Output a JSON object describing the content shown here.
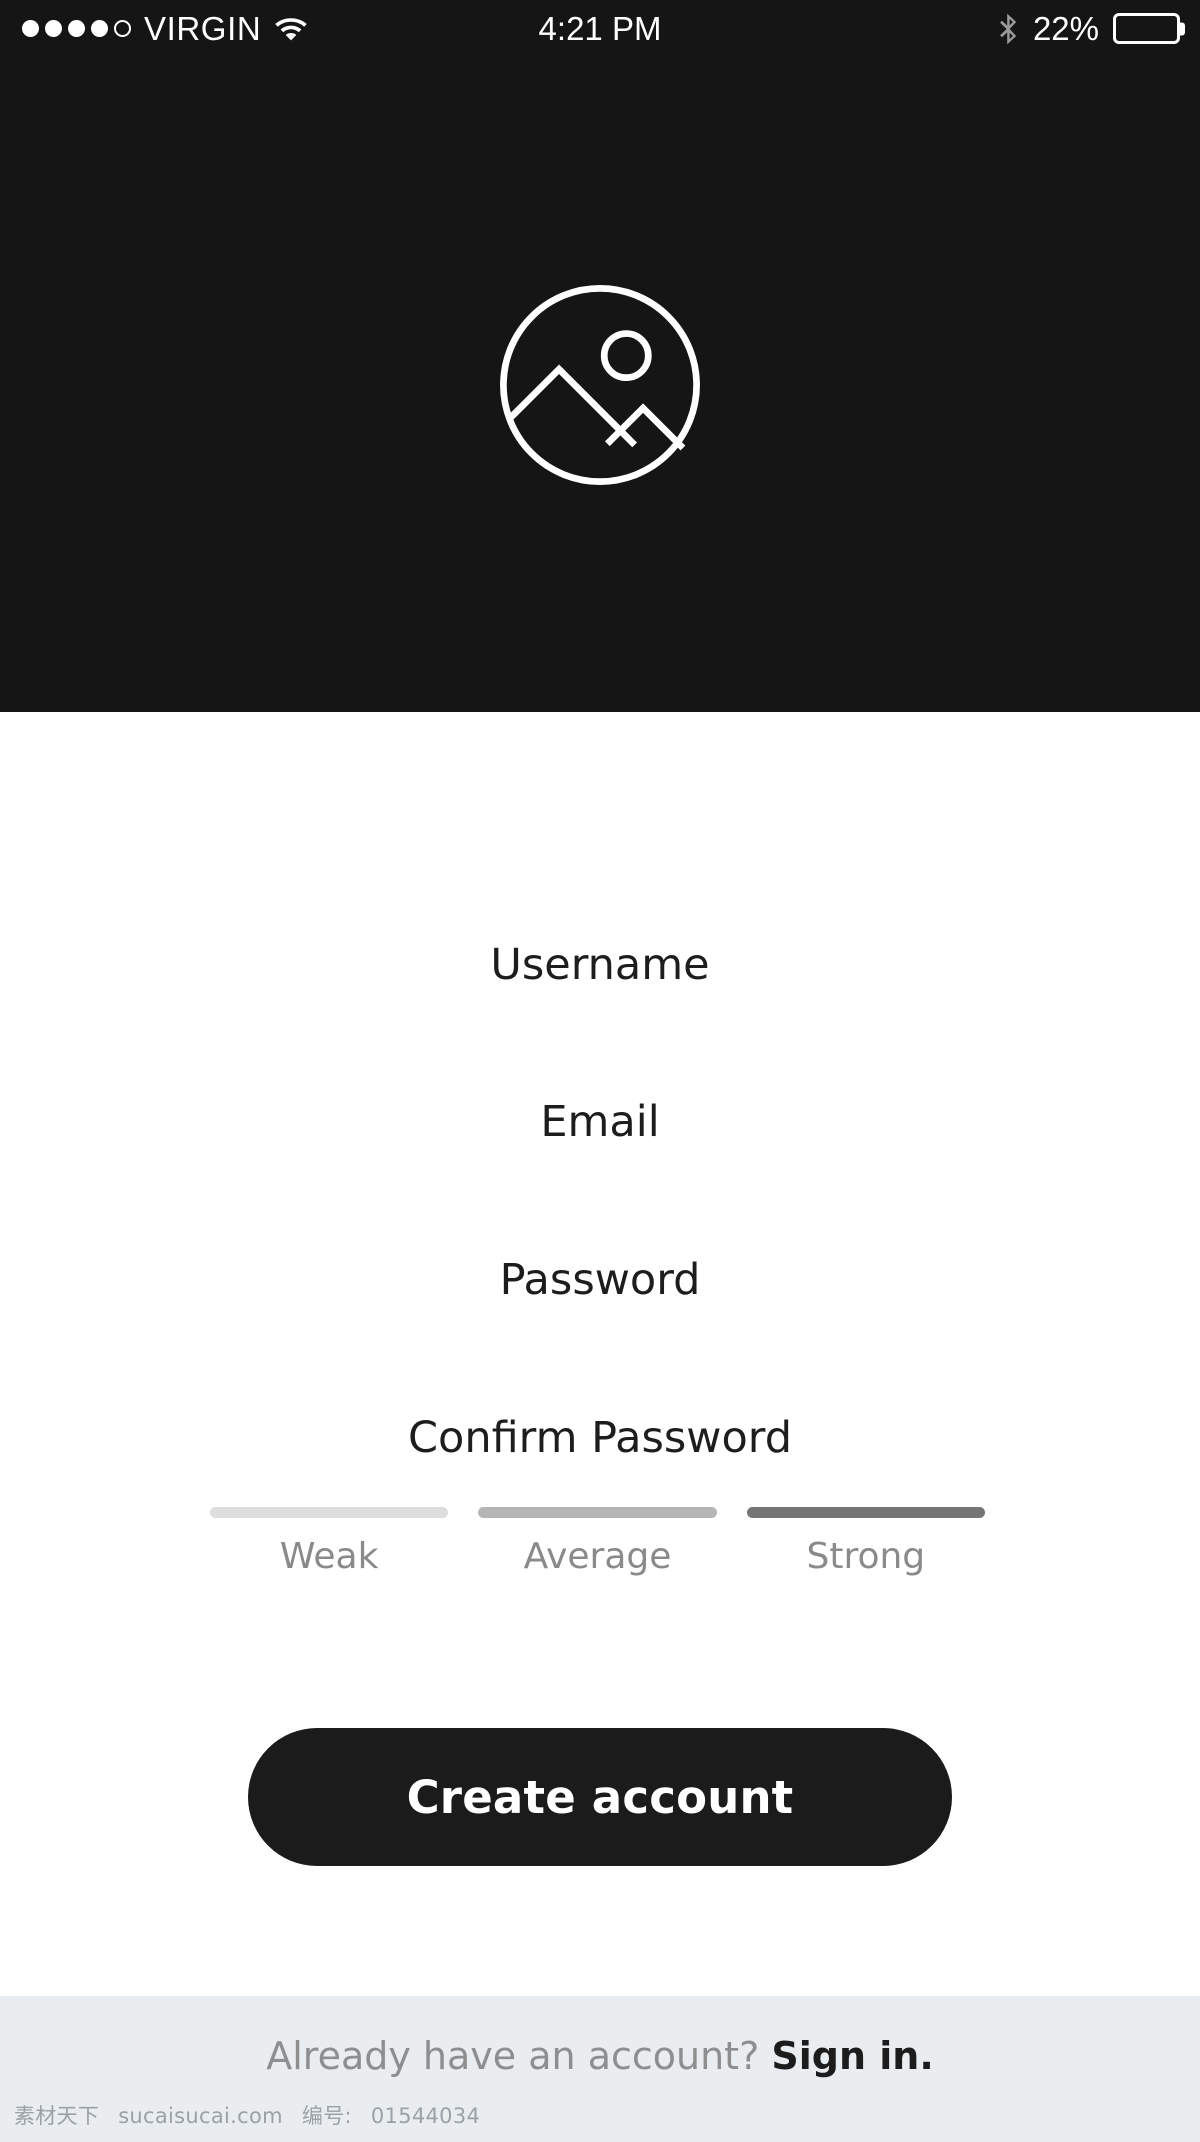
{
  "status_bar": {
    "signal_dots_total": 5,
    "signal_dots_filled": 4,
    "carrier": "VIRGIN",
    "wifi_icon": "wifi-icon",
    "time": "4:21 PM",
    "bluetooth_icon": "bluetooth-icon",
    "battery_percent_label": "22%",
    "battery_level": 22,
    "background_color": "#151515",
    "foreground_color": "#ffffff"
  },
  "hero": {
    "logo_icon": "image-placeholder-icon",
    "background_color": "#151515",
    "icon_color": "#ffffff"
  },
  "form": {
    "fields": [
      {
        "name": "username",
        "label": "Username",
        "value": "",
        "placeholder": "Username"
      },
      {
        "name": "email",
        "label": "Email",
        "value": "",
        "placeholder": "Email"
      },
      {
        "name": "password",
        "label": "Password",
        "value": "",
        "placeholder": "Password"
      },
      {
        "name": "confirm_password",
        "label": "Confirm Password",
        "value": "",
        "placeholder": "Confirm Password"
      }
    ],
    "password_strength": {
      "levels": [
        {
          "label": "Weak",
          "color": "#dddddd"
        },
        {
          "label": "Average",
          "color": "#b5b5b5"
        },
        {
          "label": "Strong",
          "color": "#757575"
        }
      ],
      "label_color": "#8a8a8a"
    },
    "submit_button": {
      "label": "Create account",
      "background_color": "#1b1b1b",
      "text_color": "#ffffff"
    }
  },
  "footer": {
    "prompt_text": "Already have an account?",
    "link_text": "Sign in.",
    "background_color": "#e9edf0",
    "prompt_color": "#8e8e8e",
    "link_color": "#1c1c1c"
  },
  "watermark": {
    "site_cn": "素材天下",
    "site_url": "sucaisucai.com",
    "id_label": "编号:",
    "id_value": "01544034"
  }
}
